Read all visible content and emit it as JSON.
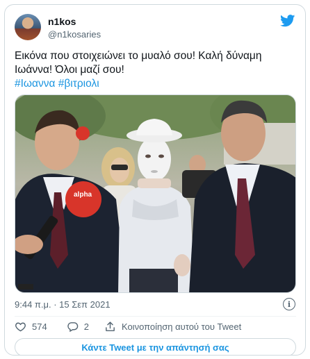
{
  "tweet": {
    "author": {
      "name": "n1kos",
      "handle": "@n1kosaries"
    },
    "text_lines": [
      "Εικόνα που στοιχειώνει το μυαλό σου! Καλή δύναμη",
      "Ιωάννα! Όλοι μαζί σου!"
    ],
    "hashtags": [
      "#Ιωαννα",
      "#βιτριολι"
    ],
    "timestamp": "9:44 π.μ. · 15 Σεπ 2021",
    "likes": "574",
    "replies": "2",
    "share_label": "Κοινοποίηση αυτού του Tweet",
    "reply_cta": "Κάντε Tweet με την απάντησή σας",
    "info_icon_label": "i"
  },
  "media": {
    "alt": "photo",
    "mic_brand": "alpha"
  },
  "icons": {
    "bird": "twitter-bird-icon",
    "info": "info-icon",
    "like": "heart-icon",
    "reply": "comment-icon",
    "share": "share-icon"
  },
  "colors": {
    "accent": "#1b95e0",
    "muted": "#536471",
    "text": "#0f1419",
    "border": "#cfd9de"
  }
}
